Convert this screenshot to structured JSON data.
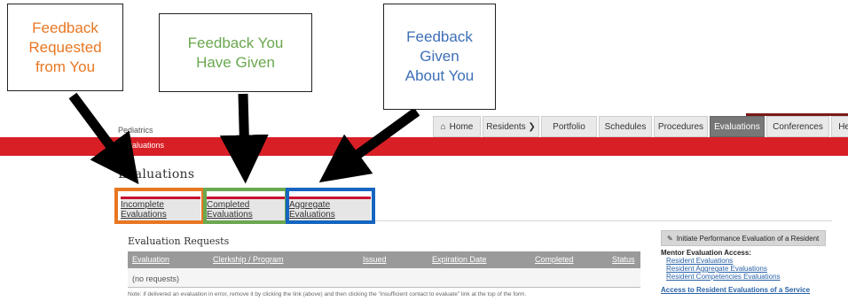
{
  "app": {
    "department": "Pediatrics",
    "breadcrumb": "me › Evaluations"
  },
  "nav": [
    {
      "label": "Home",
      "icon": "home-icon"
    },
    {
      "label": "Residents ❯"
    },
    {
      "label": "Portfolio"
    },
    {
      "label": "Schedules"
    },
    {
      "label": "Procedures"
    },
    {
      "label": "Evaluations",
      "active": true
    },
    {
      "label": "Conferences"
    },
    {
      "label": "Help"
    }
  ],
  "page": {
    "title": "Evaluations"
  },
  "tabs": [
    {
      "label": "Incomplete Evaluations"
    },
    {
      "label": "Completed Evaluations"
    },
    {
      "label": "Aggregate Evaluations"
    }
  ],
  "callouts": [
    {
      "text": "Feedback Requested from You",
      "color": "#e87722"
    },
    {
      "text": "Feedback You Have Given",
      "color": "#6aa84f"
    },
    {
      "text": "Feedback Given About You",
      "color": "#3d6fb6"
    }
  ],
  "requests": {
    "title": "Evaluation Requests",
    "columns": [
      "Evaluation",
      "Clerkship / Program",
      "Issued",
      "Expiration Date",
      "Completed",
      "Status"
    ],
    "empty_text": "(no requests)",
    "note": "Note: if delivered an evaluation in error, remove it by clicking the link (above) and then clicking the \"insufficient contact to evaluate\" link at the top of the form."
  },
  "sidebar": {
    "initiate_label": "Initiate Performance Evaluation of a Resident",
    "mentor_title": "Mentor Evaluation Access:",
    "links": [
      "Resident Evaluations",
      "Resident Aggregate Evaluations",
      "Resident Competencies Evaluations"
    ],
    "access_link": "Access to Resident Evaluations of a Service"
  },
  "colors": {
    "brand_red": "#d81f26",
    "orange": "#e87722",
    "green": "#6aa84f",
    "blue": "#1565c0"
  }
}
